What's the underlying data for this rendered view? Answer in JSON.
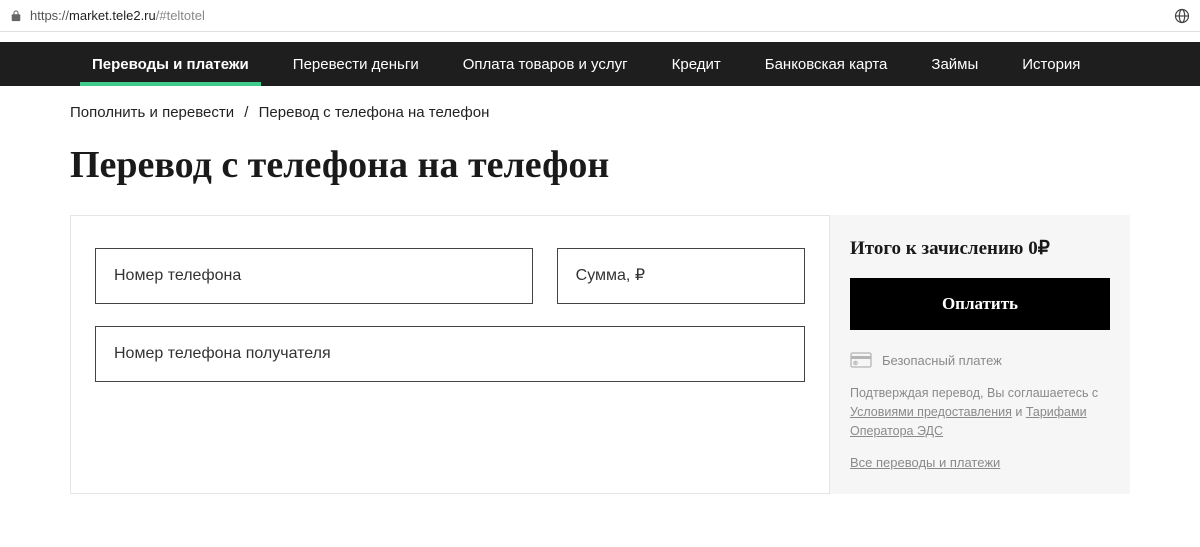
{
  "browser": {
    "url_prefix": "https://",
    "url_domain": "market.tele2.ru",
    "url_hash": "/#teltotel"
  },
  "nav": {
    "items": [
      {
        "label": "Переводы и платежи",
        "active": true
      },
      {
        "label": "Перевести деньги",
        "active": false
      },
      {
        "label": "Оплата товаров и услуг",
        "active": false
      },
      {
        "label": "Кредит",
        "active": false
      },
      {
        "label": "Банковская карта",
        "active": false
      },
      {
        "label": "Займы",
        "active": false
      },
      {
        "label": "История",
        "active": false
      }
    ]
  },
  "breadcrumb": {
    "parent": "Пополнить и перевести",
    "separator": "/",
    "current": "Перевод с телефона на телефон"
  },
  "page": {
    "title": "Перевод с телефона на телефон"
  },
  "form": {
    "phone_placeholder": "Номер телефона",
    "amount_placeholder": "Сумма, ₽",
    "recipient_placeholder": "Номер телефона получателя"
  },
  "sidebar": {
    "total_label": "Итого к зачислению 0₽",
    "pay_button": "Оплатить",
    "secure_label": "Безопасный платеж",
    "disclaimer_prefix": "Подтверждая перевод, Вы соглашаетесь с ",
    "terms_link": "Условиями предоставления",
    "disclaimer_and": " и ",
    "tariffs_link": "Тарифами Оператора ЭДС",
    "all_transfers_link": "Все переводы и платежи"
  }
}
